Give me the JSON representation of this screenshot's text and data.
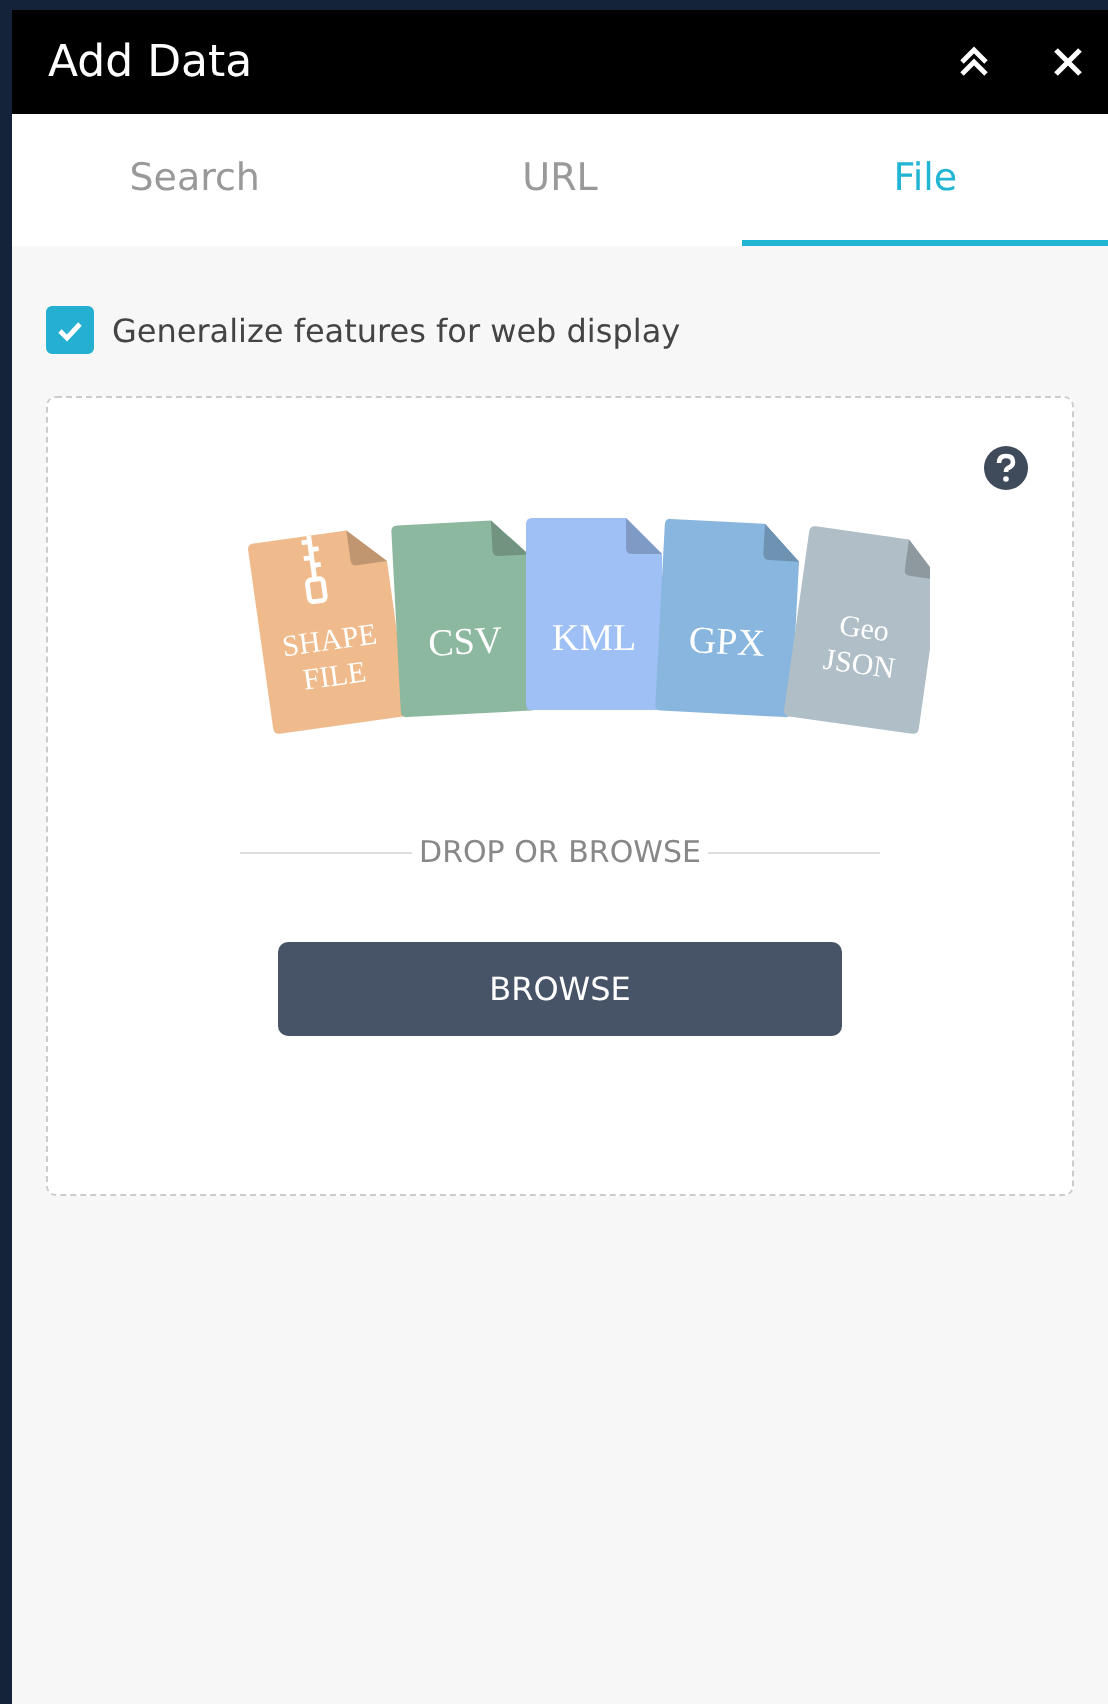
{
  "window": {
    "title": "Add Data"
  },
  "tabs": [
    {
      "label": "Search",
      "selected": false
    },
    {
      "label": "URL",
      "selected": false
    },
    {
      "label": "File",
      "selected": true
    }
  ],
  "generalize": {
    "label": "Generalize features for web display",
    "checked": true
  },
  "file_types": [
    {
      "lines": [
        "SHAPE",
        "FILE"
      ],
      "color": "#f0bb8c",
      "zipped": true
    },
    {
      "lines": [
        "CSV"
      ],
      "color": "#8db8a0",
      "zipped": false
    },
    {
      "lines": [
        "KML"
      ],
      "color": "#9fc0f5",
      "zipped": false
    },
    {
      "lines": [
        "GPX"
      ],
      "color": "#88b6de",
      "zipped": false
    },
    {
      "lines": [
        "Geo",
        "JSON"
      ],
      "color": "#b0bec7",
      "zipped": false
    }
  ],
  "drop_label": "DROP OR BROWSE",
  "browse_button": "BROWSE"
}
